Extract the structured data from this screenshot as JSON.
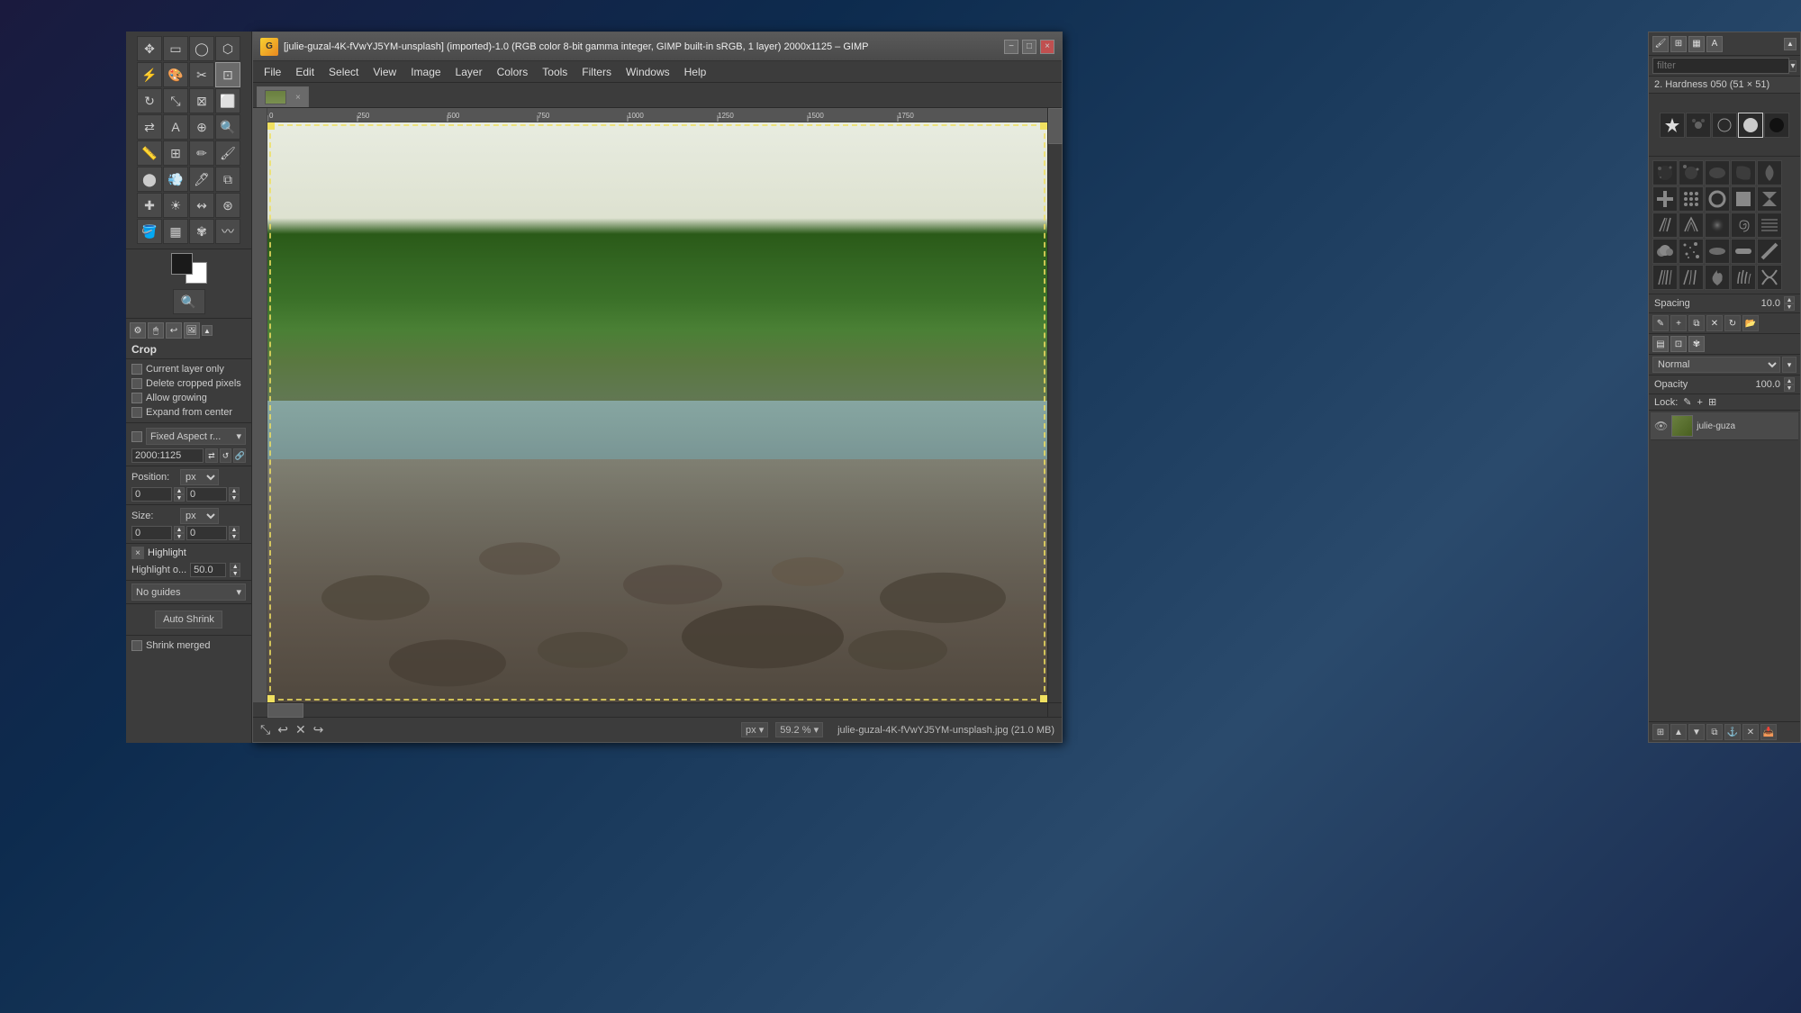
{
  "window": {
    "title": "[julie-guzal-4K-fVwYJ5YM-unsplash] (imported)-1.0 (RGB color 8-bit gamma integer, GIMP built-in sRGB, 1 layer) 2000x1125 – GIMP",
    "close_label": "×",
    "maximize_label": "□",
    "minimize_label": "−"
  },
  "menu": {
    "items": [
      "File",
      "Edit",
      "Select",
      "View",
      "Image",
      "Layer",
      "Colors",
      "Tools",
      "Filters",
      "Windows",
      "Help"
    ]
  },
  "image_tab": {
    "label": "",
    "close": "×"
  },
  "toolbox": {
    "tools": [
      {
        "name": "move-tool",
        "icon": "✥"
      },
      {
        "name": "rect-select-tool",
        "icon": "▭"
      },
      {
        "name": "ellipse-select-tool",
        "icon": "◯"
      },
      {
        "name": "free-select-tool",
        "icon": "⬡"
      },
      {
        "name": "fuzzy-select-tool",
        "icon": "⬢"
      },
      {
        "name": "by-color-tool",
        "icon": "🎨"
      },
      {
        "name": "scissors-tool",
        "icon": "✂"
      },
      {
        "name": "crop-tool",
        "icon": "⊡",
        "active": true
      },
      {
        "name": "rotate-tool",
        "icon": "↻"
      },
      {
        "name": "scale-tool",
        "icon": "⤡"
      },
      {
        "name": "shear-tool",
        "icon": "⊠"
      },
      {
        "name": "perspective-tool",
        "icon": "⬜"
      },
      {
        "name": "flip-tool",
        "icon": "⇄"
      },
      {
        "name": "text-tool",
        "icon": "A"
      },
      {
        "name": "color-picker-tool",
        "icon": "⊕"
      },
      {
        "name": "pencil-tool",
        "icon": "✏"
      },
      {
        "name": "paintbrush-tool",
        "icon": "🖌"
      },
      {
        "name": "eraser-tool",
        "icon": "⬜"
      },
      {
        "name": "airbrush-tool",
        "icon": "💨"
      },
      {
        "name": "ink-tool",
        "icon": "🖊"
      },
      {
        "name": "clone-tool",
        "icon": "⧉"
      },
      {
        "name": "heal-tool",
        "icon": "✚"
      },
      {
        "name": "dodge-burn-tool",
        "icon": "☀"
      },
      {
        "name": "smudge-tool",
        "icon": "↭"
      },
      {
        "name": "convolve-tool",
        "icon": "⊛"
      },
      {
        "name": "bucket-fill-tool",
        "icon": "🪣"
      },
      {
        "name": "blend-tool",
        "icon": "▦"
      },
      {
        "name": "paths-tool",
        "icon": "✾"
      },
      {
        "name": "zoom-tool",
        "icon": "🔍"
      },
      {
        "name": "measure-tool",
        "icon": "📏"
      },
      {
        "name": "align-tool",
        "icon": "⊞"
      },
      {
        "name": "warp-tool",
        "icon": "〰"
      }
    ],
    "fg_color": "#1a1a1a",
    "bg_color": "#ffffff"
  },
  "tool_options": {
    "title": "Crop",
    "current_layer_only": false,
    "delete_cropped_pixels": false,
    "allow_growing": false,
    "expand_from_center": false,
    "fixed_aspect": false,
    "fixed_aspect_label": "Fixed Aspect r...",
    "aspect_value": "2000:1125",
    "position_unit": "px",
    "position_x": "0",
    "position_y": "0",
    "size_unit": "px",
    "size_w": "0",
    "size_h": "0",
    "highlight": {
      "enabled": true,
      "label": "Highlight",
      "opacity_label": "Highlight o...",
      "opacity_value": "50.0"
    },
    "guides_label": "No guides",
    "auto_shrink_label": "Auto Shrink",
    "shrink_merged": false,
    "shrink_merged_label": "Shrink merged"
  },
  "brush_panel": {
    "filter_placeholder": "filter",
    "header": "2. Hardness 050 (51 × 51)",
    "spacing_label": "Spacing",
    "spacing_value": "10.0",
    "brushes": [
      {
        "name": "brush-star"
      },
      {
        "name": "brush-dots1"
      },
      {
        "name": "brush-small-circle"
      },
      {
        "name": "brush-white-circle"
      },
      {
        "name": "brush-hard-circle"
      },
      {
        "name": "brush-black-circle"
      },
      {
        "name": "brush-spatter1"
      },
      {
        "name": "brush-spatter2"
      },
      {
        "name": "brush-spatter3"
      },
      {
        "name": "brush-leaf"
      },
      {
        "name": "brush-cross"
      },
      {
        "name": "brush-dotted"
      },
      {
        "name": "brush-ring"
      },
      {
        "name": "brush-square"
      },
      {
        "name": "brush-bowtie"
      },
      {
        "name": "brush-fur1"
      },
      {
        "name": "brush-fur2"
      },
      {
        "name": "brush-fuzzy"
      },
      {
        "name": "brush-spiral"
      },
      {
        "name": "brush-lines"
      },
      {
        "name": "brush-cloud"
      },
      {
        "name": "brush-dots2"
      },
      {
        "name": "brush-smear"
      },
      {
        "name": "brush-wide"
      },
      {
        "name": "brush-diagonal"
      },
      {
        "name": "brush-bristle1"
      },
      {
        "name": "brush-bristle2"
      },
      {
        "name": "brush-flame"
      },
      {
        "name": "brush-grass"
      },
      {
        "name": "brush-wire"
      }
    ]
  },
  "layers_panel": {
    "mode_label": "Normal",
    "opacity_label": "Opacity",
    "opacity_value": "100.0",
    "lock_label": "Lock:",
    "lock_icons": [
      "✎",
      "+",
      "⊞"
    ],
    "layers": [
      {
        "name": "julie-guza",
        "visible": true
      }
    ]
  },
  "status_bar": {
    "unit": "px",
    "zoom": "59.2 %",
    "filename": "julie-guzal-4K-fVwYJ5YM-unsplash.jpg (21.0 MB)"
  },
  "ruler": {
    "ticks": [
      "0",
      "250",
      "500",
      "750",
      "1000",
      "1250",
      "1500",
      "1750"
    ]
  },
  "colors": {
    "bg_app": "#1a1a2e",
    "bg_window": "#3c3c3c",
    "bg_panel": "#3c3c3c",
    "bg_input": "#2a2a2a",
    "border": "#2a2a2a",
    "text_primary": "#dddddd",
    "text_secondary": "#aaaaaa",
    "accent": "#6a6a6a"
  }
}
